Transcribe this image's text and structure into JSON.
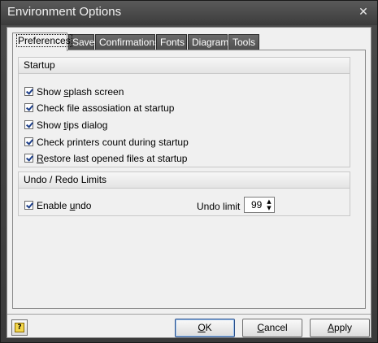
{
  "window": {
    "title": "Environment Options"
  },
  "tabs": [
    {
      "label": "Preferences",
      "active": true
    },
    {
      "label": "Save"
    },
    {
      "label": "Confirmations"
    },
    {
      "label": "Fonts"
    },
    {
      "label": "Diagram"
    },
    {
      "label": "Tools"
    }
  ],
  "startup": {
    "title": "Startup",
    "options": [
      {
        "pre": "Show ",
        "mn": "s",
        "post": "plash screen",
        "checked": true
      },
      {
        "pre": "Check file assosiation at startup",
        "mn": "",
        "post": "",
        "checked": true
      },
      {
        "pre": "Show ",
        "mn": "t",
        "post": "ips dialog",
        "checked": true
      },
      {
        "pre": "Check printers count during startup",
        "mn": "",
        "post": "",
        "checked": true
      },
      {
        "pre": "",
        "mn": "R",
        "post": "estore last opened files at startup",
        "checked": true
      }
    ]
  },
  "undo": {
    "title": "Undo / Redo Limits",
    "enable_pre": "Enable ",
    "enable_mn": "u",
    "enable_post": "ndo",
    "enable_checked": true,
    "limit_label": "Undo limit",
    "limit_value": "99"
  },
  "buttons": {
    "ok_mn": "O",
    "ok_post": "K",
    "cancel_mn": "C",
    "cancel_post": "ancel",
    "apply_mn": "A",
    "apply_post": "pply"
  },
  "help_icon": "?"
}
